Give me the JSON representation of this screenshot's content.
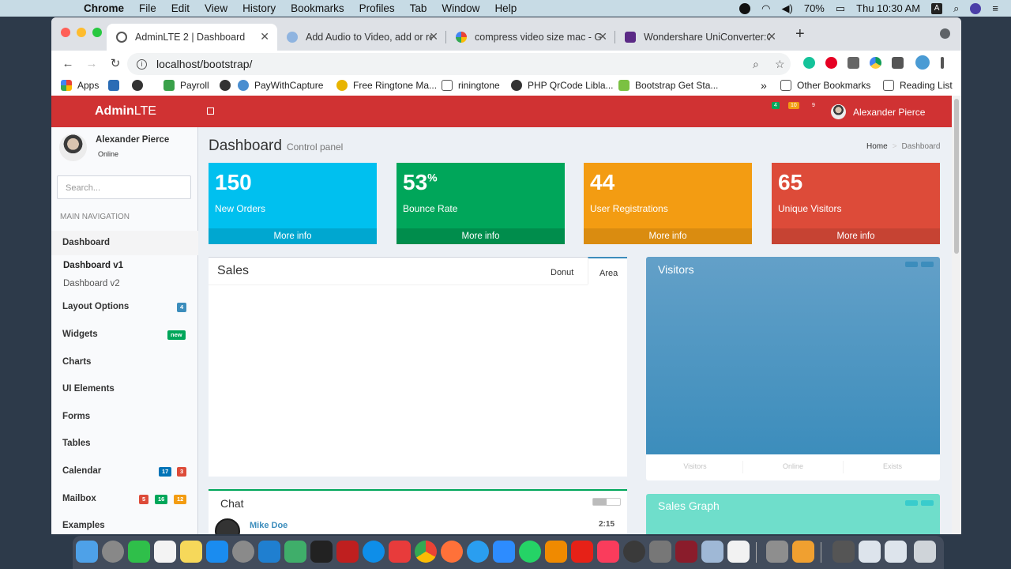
{
  "menubar": {
    "app": "Chrome",
    "items": [
      "File",
      "Edit",
      "View",
      "History",
      "Bookmarks",
      "Profiles",
      "Tab",
      "Window",
      "Help"
    ],
    "battery": "70%",
    "clock": "Thu 10:30 AM",
    "input_source": "A"
  },
  "tabs": [
    {
      "title": "AdminLTE 2 | Dashboard",
      "active": true
    },
    {
      "title": "Add Audio to Video, add or rep",
      "active": false
    },
    {
      "title": "compress video size mac - Goo",
      "active": false
    },
    {
      "title": "Wondershare UniConverter:Co",
      "active": false
    }
  ],
  "address": {
    "url": "localhost/bootstrap/"
  },
  "bookmarks": {
    "items": [
      "Apps",
      "Payroll",
      "PayWithCapture",
      "Free Ringtone Ma...",
      "riningtone",
      "PHP QrCode Libla...",
      "Bootstrap Get Sta..."
    ],
    "overflow": "»",
    "other": "Other Bookmarks",
    "reading_list": "Reading List"
  },
  "header": {
    "logo_bold": "Admin",
    "logo_light": "LTE",
    "badges": [
      "4",
      "10",
      "9"
    ],
    "user": "Alexander Pierce"
  },
  "sidebar": {
    "user_name": "Alexander Pierce",
    "user_status": "Online",
    "search_placeholder": "Search...",
    "nav_header": "MAIN NAVIGATION",
    "items": [
      {
        "label": "Dashboard"
      },
      {
        "label": "Dashboard v1"
      },
      {
        "label": "Dashboard v2"
      },
      {
        "label": "Layout Options",
        "badge": "4"
      },
      {
        "label": "Widgets",
        "badge": "new"
      },
      {
        "label": "Charts"
      },
      {
        "label": "UI Elements"
      },
      {
        "label": "Forms"
      },
      {
        "label": "Tables"
      },
      {
        "label": "Calendar",
        "badges": [
          "17",
          "3"
        ]
      },
      {
        "label": "Mailbox",
        "badges": [
          "5",
          "16",
          "12"
        ]
      },
      {
        "label": "Examples"
      }
    ]
  },
  "page": {
    "title": "Dashboard",
    "subtitle": "Control panel",
    "breadcrumb": {
      "home": "Home",
      "current": "Dashboard"
    }
  },
  "stats": [
    {
      "value": "150",
      "label": "New Orders",
      "more": "More info",
      "color": "#00c0ef"
    },
    {
      "value": "53",
      "unit": "%",
      "label": "Bounce Rate",
      "more": "More info",
      "color": "#00a65a"
    },
    {
      "value": "44",
      "label": "User Registrations",
      "more": "More info",
      "color": "#f39c12"
    },
    {
      "value": "65",
      "label": "Unique Visitors",
      "more": "More info",
      "color": "#dd4b39"
    }
  ],
  "sales": {
    "title": "Sales",
    "tabs": [
      "Donut",
      "Area"
    ],
    "active_tab": "Area"
  },
  "chat": {
    "title": "Chat",
    "first_name": "Mike Doe",
    "first_time": "2:15"
  },
  "visitors": {
    "title": "Visitors",
    "kpis": [
      "Visitors",
      "Online",
      "Exists"
    ]
  },
  "sales_graph": {
    "title": "Sales Graph"
  }
}
